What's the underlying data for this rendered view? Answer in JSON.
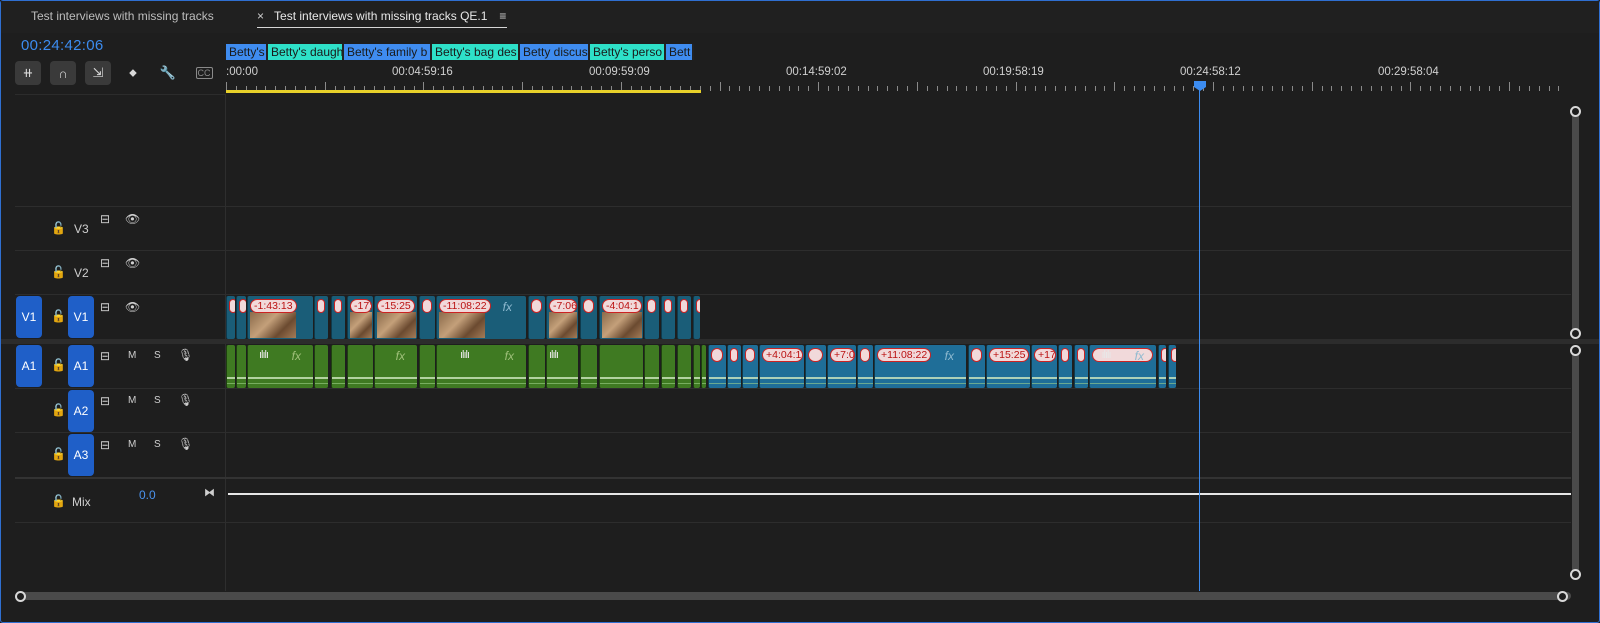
{
  "tabs": [
    {
      "label": "Test interviews with missing tracks"
    },
    {
      "label": "Test interviews with missing tracks QE.1",
      "close": "×",
      "menu": "≡"
    }
  ],
  "timecode": "00:24:42:06",
  "toolbar": [
    {
      "icon": "insert-overwrite-icon",
      "glyph": "⧺"
    },
    {
      "icon": "snap-magnet-icon",
      "glyph": "∩"
    },
    {
      "icon": "linked-selection-icon",
      "glyph": "⇲"
    },
    {
      "icon": "add-marker-icon",
      "glyph": "⬥"
    },
    {
      "icon": "timeline-settings-wrench-icon",
      "glyph": "🔧"
    },
    {
      "icon": "closed-captions-icon",
      "glyph": "CC"
    }
  ],
  "ruler_labels": [
    ":00:00",
    "00:04:59:16",
    "00:09:59:09",
    "00:14:59:02",
    "00:19:58:19",
    "00:24:58:12",
    "00:29:58:04"
  ],
  "markers": [
    {
      "label": "Betty's",
      "color": "blue"
    },
    {
      "label": "Betty's daugh",
      "color": "teal"
    },
    {
      "label": "Betty's family b",
      "color": "blue"
    },
    {
      "label": "Betty's bag des",
      "color": "teal"
    },
    {
      "label": "Betty discus",
      "color": "blue"
    },
    {
      "label": "Betty's perso",
      "color": "teal"
    },
    {
      "label": "Bett",
      "color": "blue"
    }
  ],
  "tracks": {
    "video": [
      {
        "name": "V3",
        "source": ""
      },
      {
        "name": "V2",
        "source": ""
      },
      {
        "name": "V1",
        "source": "V1"
      }
    ],
    "audio": [
      {
        "name": "A1",
        "source": "A1",
        "m": "M",
        "s": "S"
      },
      {
        "name": "A2",
        "source": "",
        "m": "M",
        "s": "S"
      },
      {
        "name": "A3",
        "source": "",
        "m": "M",
        "s": "S"
      }
    ],
    "mix": {
      "name": "Mix",
      "value": "0.0"
    }
  },
  "video_badges": [
    "-1:43:13",
    "-17:",
    "-15:25",
    "-11:08:22",
    "-7:06",
    "-4:04:1"
  ],
  "audio_badges": [
    "+4:04:1",
    "+7:0",
    "+11:08:22",
    "+15:25",
    "+17"
  ],
  "fx_label": "fx"
}
